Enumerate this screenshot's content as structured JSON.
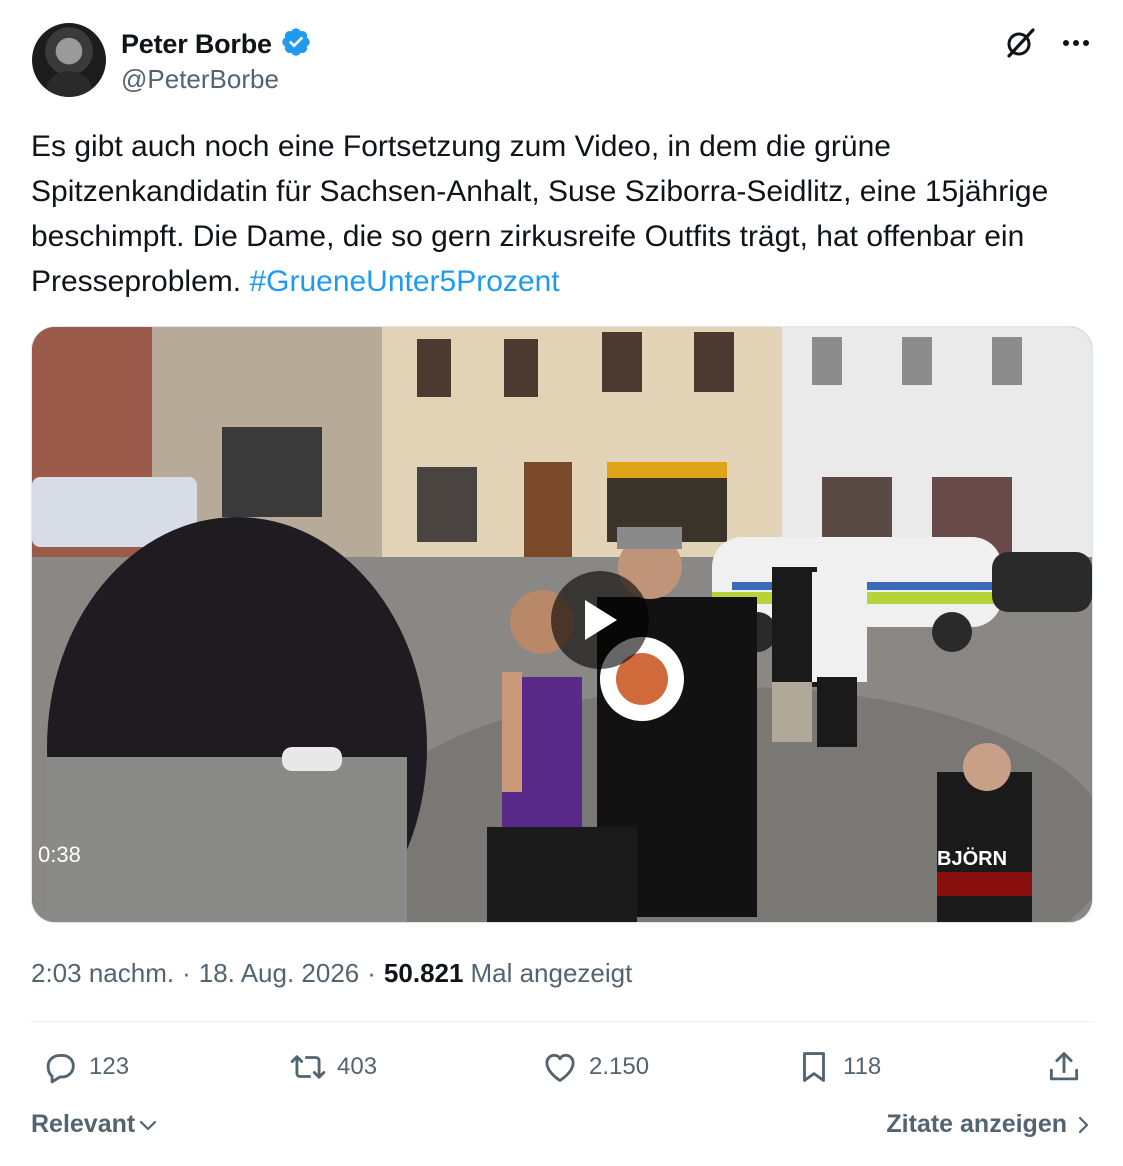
{
  "author": {
    "display_name": "Peter Borbe",
    "handle": "@PeterBorbe",
    "verified": true
  },
  "tweet": {
    "text": "Es gibt auch noch eine Fortsetzung zum Video, in dem die grüne Spitzenkandidatin für Sachsen-Anhalt, Suse Sziborra-Seidlitz, eine 15jährige beschimpft. Die Dame, die so gern zirkusreife Outfits trägt, hat offenbar ein Presseproblem.",
    "hashtag": "#GrueneUnter5Prozent"
  },
  "media": {
    "type": "video",
    "duration": "0:38",
    "watermark": "BJÖRN"
  },
  "meta": {
    "time": "2:03 nachm.",
    "date": "18. Aug. 2026",
    "views": "50.821",
    "views_label": "Mal angezeigt",
    "separator": "·"
  },
  "actions": {
    "replies": "123",
    "retweets": "403",
    "likes": "2.150",
    "bookmarks": "118"
  },
  "footer": {
    "sort_label": "Relevant",
    "quotes_label": "Zitate anzeigen"
  },
  "colors": {
    "accent": "#1d9bf0",
    "text": "#0f1419",
    "secondary": "#536471"
  },
  "icons": [
    "verified-badge-icon",
    "grok-icon",
    "more-icon",
    "play-icon",
    "reply-icon",
    "retweet-icon",
    "like-icon",
    "bookmark-icon",
    "share-icon",
    "chevron-down-icon",
    "chevron-right-icon"
  ]
}
